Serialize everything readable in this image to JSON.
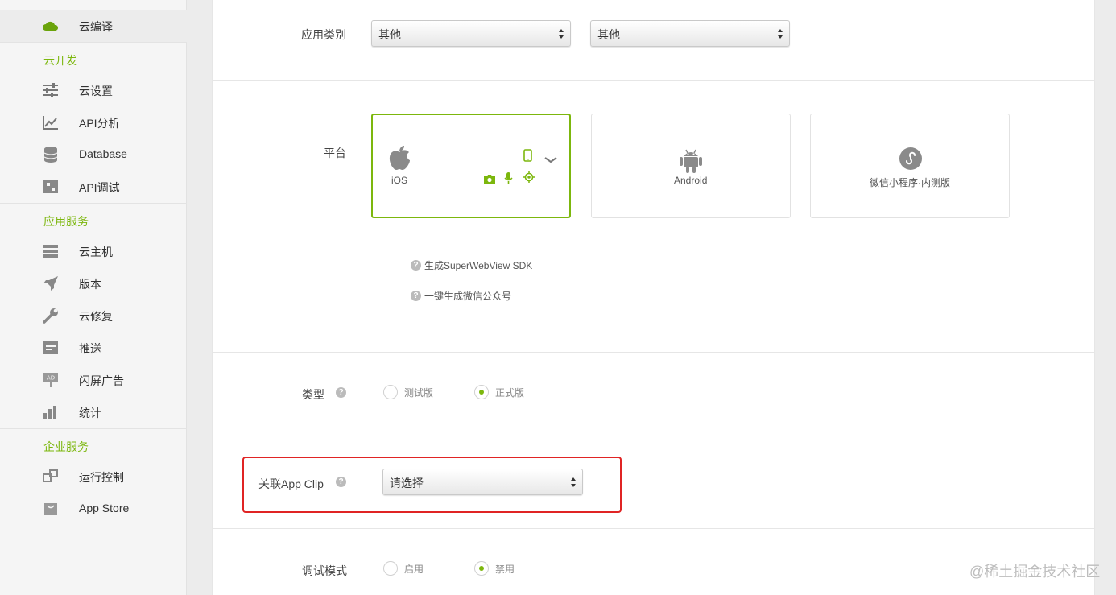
{
  "sidebar": {
    "items_top": [
      {
        "label": "云编译",
        "icon": "cloud-icon",
        "active": true
      }
    ],
    "groups": [
      {
        "title": "云开发",
        "items": [
          {
            "label": "云设置",
            "icon": "sliders-icon"
          },
          {
            "label": "API分析",
            "icon": "chart-line-icon"
          },
          {
            "label": "Database",
            "icon": "database-icon"
          },
          {
            "label": "API调试",
            "icon": "debug-icon"
          }
        ]
      },
      {
        "title": "应用服务",
        "items": [
          {
            "label": "云主机",
            "icon": "server-icon"
          },
          {
            "label": "版本",
            "icon": "rocket-icon"
          },
          {
            "label": "云修复",
            "icon": "wrench-icon"
          },
          {
            "label": "推送",
            "icon": "push-icon"
          },
          {
            "label": "闪屏广告",
            "icon": "ad-icon"
          },
          {
            "label": "统计",
            "icon": "bar-chart-icon"
          }
        ]
      },
      {
        "title": "企业服务",
        "items": [
          {
            "label": "运行控制",
            "icon": "control-icon"
          },
          {
            "label": "App Store",
            "icon": "bag-icon"
          }
        ]
      }
    ]
  },
  "form": {
    "category": {
      "label": "应用类别",
      "select1": "其他",
      "select2": "其他"
    },
    "platform": {
      "label": "平台",
      "cards": [
        {
          "title": "iOS",
          "icon": "apple-icon",
          "selected": true
        },
        {
          "title": "Android",
          "icon": "android-icon",
          "selected": false
        },
        {
          "title": "微信小程序·内测版",
          "icon": "wechat-miniprogram-icon",
          "selected": false
        }
      ],
      "help": [
        "生成SuperWebView SDK",
        "一键生成微信公众号"
      ]
    },
    "type": {
      "label": "类型",
      "options": [
        "测试版",
        "正式版"
      ],
      "selected": "正式版"
    },
    "appclip": {
      "label": "关联App Clip",
      "placeholder": "请选择"
    },
    "debug": {
      "label": "调试模式",
      "options": [
        "启用",
        "禁用"
      ],
      "selected": "禁用"
    }
  },
  "watermark": "@稀土掘金技术社区",
  "colors": {
    "accent": "#7cb70d",
    "highlight": "#e02424"
  }
}
